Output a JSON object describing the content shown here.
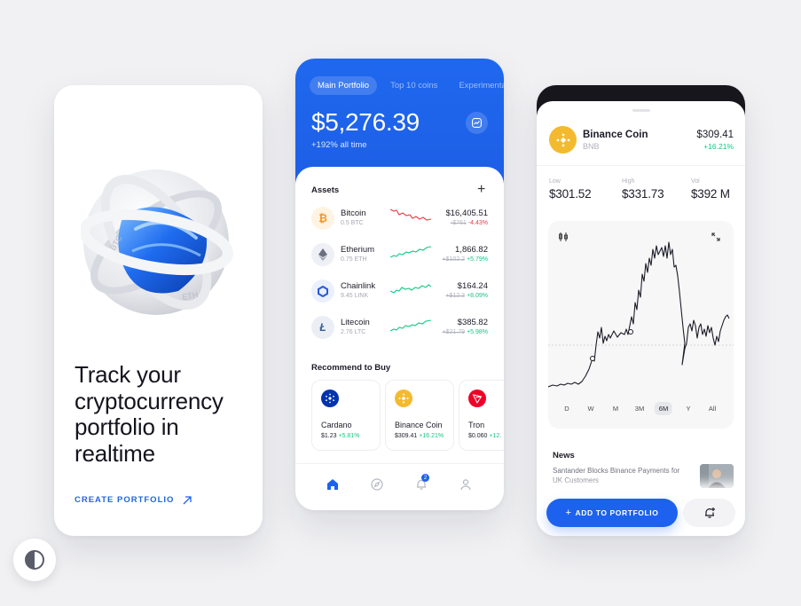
{
  "onboarding": {
    "headline": "Track your cryptocurrency portfolio in realtime",
    "cta_label": "CREATE PORTFOLIO"
  },
  "portfolio": {
    "tabs": [
      {
        "label": "Main Portfolio",
        "active": true
      },
      {
        "label": "Top 10 coins",
        "active": false
      },
      {
        "label": "Experimental",
        "active": false
      }
    ],
    "balance": "$5,276.39",
    "change": "+192% all time",
    "assets_title": "Assets",
    "assets": [
      {
        "name": "Bitcoin",
        "amount": "0.5 BTC",
        "price": "$16,405.51",
        "old": "-$761",
        "delta": "-4.43%",
        "trend": "down",
        "icon": "bitcoin-icon",
        "color": "#f7931a"
      },
      {
        "name": "Etherium",
        "amount": "0.75 ETH",
        "price": "1,866.82",
        "old": "+$102.2",
        "delta": "+5.79%",
        "trend": "up",
        "icon": "ethereum-icon",
        "color": "#627eea"
      },
      {
        "name": "Chainlink",
        "amount": "9.45 LINK",
        "price": "$164.24",
        "old": "+$12.3",
        "delta": "+8.09%",
        "trend": "up",
        "icon": "chainlink-icon",
        "color": "#2a5ada"
      },
      {
        "name": "Litecoin",
        "amount": "2.76 LTC",
        "price": "$385.82",
        "old": "+$21.79",
        "delta": "+5.98%",
        "trend": "up",
        "icon": "litecoin-icon",
        "color": "#345d9d"
      }
    ],
    "recommend_title": "Recommend to Buy",
    "recommend": [
      {
        "name": "Cardano",
        "price": "$1.23",
        "delta": "+5.81%",
        "icon": "cardano-icon",
        "color": "#0033ad"
      },
      {
        "name": "Binance Coin",
        "price": "$309.41",
        "delta": "+16.21%",
        "icon": "binance-icon",
        "color": "#f3ba2f"
      },
      {
        "name": "Tron",
        "price": "$0.060",
        "delta": "+12.",
        "icon": "tron-icon",
        "color": "#ef0027"
      }
    ],
    "notification_count": "2"
  },
  "detail": {
    "coin_name": "Binance Coin",
    "ticker": "BNB",
    "price": "$309.41",
    "delta": "+16.21%",
    "stats": [
      {
        "label": "Low",
        "value": "$301.52"
      },
      {
        "label": "High",
        "value": "$331.73"
      },
      {
        "label": "Vol",
        "value": "$392 M"
      }
    ],
    "periods": [
      "D",
      "W",
      "M",
      "3M",
      "6M",
      "Y",
      "All"
    ],
    "active_period": "6M",
    "news_title": "News",
    "news_headline": "Santander Blocks Binance Payments for UK Customers",
    "add_button_label": "ADD TO PORTFOLIO",
    "accent_color": "#1d62ee"
  }
}
